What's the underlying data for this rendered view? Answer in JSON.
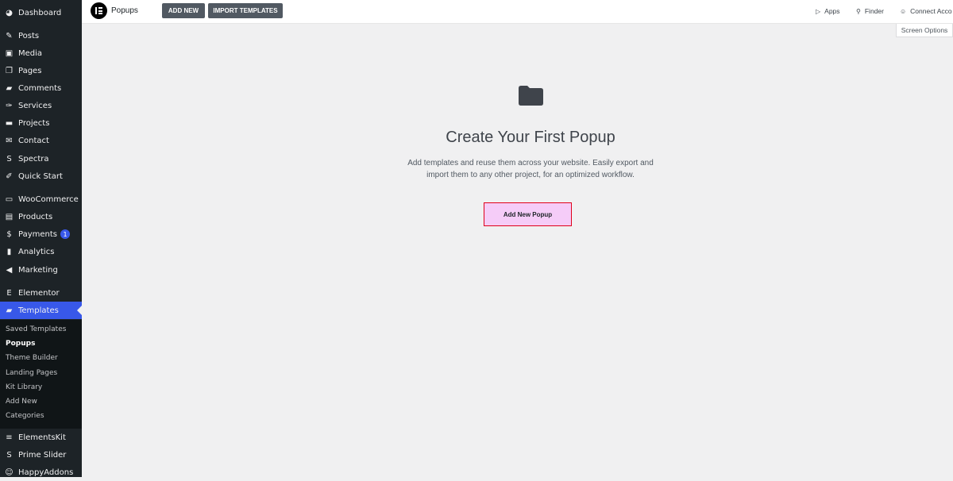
{
  "sidebar": {
    "items": [
      {
        "label": "Dashboard",
        "icon": "dashboard-icon",
        "glyph": "◕"
      },
      {
        "label": "Posts",
        "icon": "pin-icon",
        "glyph": "✎"
      },
      {
        "label": "Media",
        "icon": "media-icon",
        "glyph": "▣"
      },
      {
        "label": "Pages",
        "icon": "pages-icon",
        "glyph": "❐"
      },
      {
        "label": "Comments",
        "icon": "comment-icon",
        "glyph": "▰"
      },
      {
        "label": "Services",
        "icon": "wrench-icon",
        "glyph": "✑"
      },
      {
        "label": "Projects",
        "icon": "folder-icon",
        "glyph": "▬"
      },
      {
        "label": "Contact",
        "icon": "mail-icon",
        "glyph": "✉"
      },
      {
        "label": "Spectra",
        "icon": "spectra-icon",
        "glyph": "S"
      },
      {
        "label": "Quick Start",
        "icon": "quick-start-icon",
        "glyph": "✐"
      },
      {
        "label": "WooCommerce",
        "icon": "woocommerce-icon",
        "glyph": "▭"
      },
      {
        "label": "Products",
        "icon": "products-icon",
        "glyph": "▤"
      },
      {
        "label": "Payments",
        "icon": "payments-icon",
        "glyph": "$",
        "badge": "1"
      },
      {
        "label": "Analytics",
        "icon": "analytics-icon",
        "glyph": "▮"
      },
      {
        "label": "Marketing",
        "icon": "megaphone-icon",
        "glyph": "◀"
      },
      {
        "label": "Elementor",
        "icon": "elementor-icon",
        "glyph": "E"
      },
      {
        "label": "Templates",
        "icon": "templates-folder-icon",
        "glyph": "▰"
      },
      {
        "label": "ElementsKit",
        "icon": "elementskit-icon",
        "glyph": "≡"
      },
      {
        "label": "Prime Slider",
        "icon": "prime-slider-icon",
        "glyph": "S"
      },
      {
        "label": "HappyAddons",
        "icon": "happyaddons-icon",
        "glyph": "☺"
      }
    ],
    "submenu": [
      {
        "label": "Saved Templates"
      },
      {
        "label": "Popups",
        "current": true
      },
      {
        "label": "Theme Builder"
      },
      {
        "label": "Landing Pages"
      },
      {
        "label": "Kit Library"
      },
      {
        "label": "Add New"
      },
      {
        "label": "Categories"
      }
    ]
  },
  "topbar": {
    "title": "Popups",
    "add_new": "ADD NEW",
    "import_templates": "IMPORT TEMPLATES",
    "apps": "Apps",
    "finder": "Finder",
    "connect": "Connect Acco"
  },
  "screen_options": "Screen Options",
  "empty_state": {
    "title": "Create Your First Popup",
    "description_line1": "Add templates and reuse them across your website. Easily export and",
    "description_line2": "import them to any other project, for an optimized workflow.",
    "button": "Add New Popup"
  },
  "colors": {
    "accent": "#3858e9",
    "cta_bg": "#f5ccf8",
    "cta_border": "#e0001a"
  }
}
